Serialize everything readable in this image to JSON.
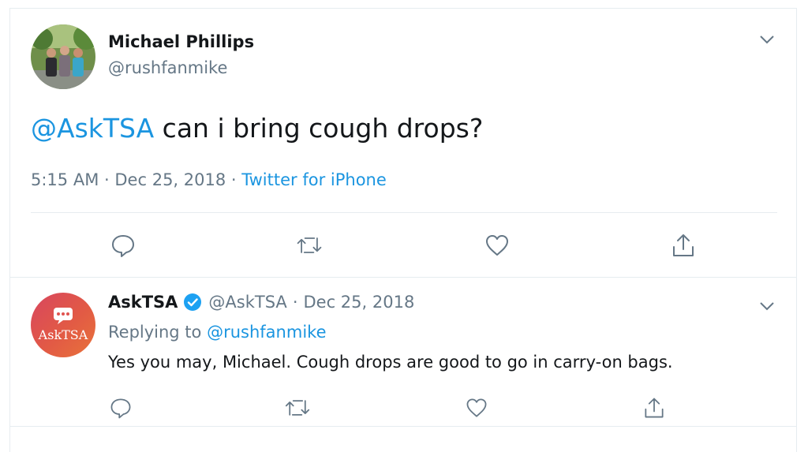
{
  "main_tweet": {
    "author_name": "Michael Phillips",
    "author_handle": "@rushfanmike",
    "mention": "@AskTSA",
    "text": "can i bring cough drops?",
    "time": "5:15 AM",
    "separator": "·",
    "date": "Dec 25, 2018",
    "source": "Twitter for iPhone",
    "actions": [
      "reply-icon",
      "retweet-icon",
      "like-icon",
      "share-icon"
    ]
  },
  "reply": {
    "author_name": "AskTSA",
    "verified": true,
    "author_handle": "@AskTSA",
    "separator": "·",
    "date": "Dec 25, 2018",
    "replying_to_label": "Replying to",
    "replying_to_handle": "@rushfanmike",
    "text": "Yes you may, Michael. Cough drops are good to go in carry-on bags.",
    "avatar_text": "AskTSA",
    "actions": [
      "reply-icon",
      "retweet-icon",
      "like-icon",
      "share-icon"
    ]
  },
  "colors": {
    "link": "#1b95e0",
    "secondary_text": "#657786",
    "primary_text": "#14171a",
    "divider": "#e6ecf0",
    "verified": "#1da1f2",
    "tsa_gradient_start": "#d8465f",
    "tsa_gradient_end": "#e8733a"
  }
}
